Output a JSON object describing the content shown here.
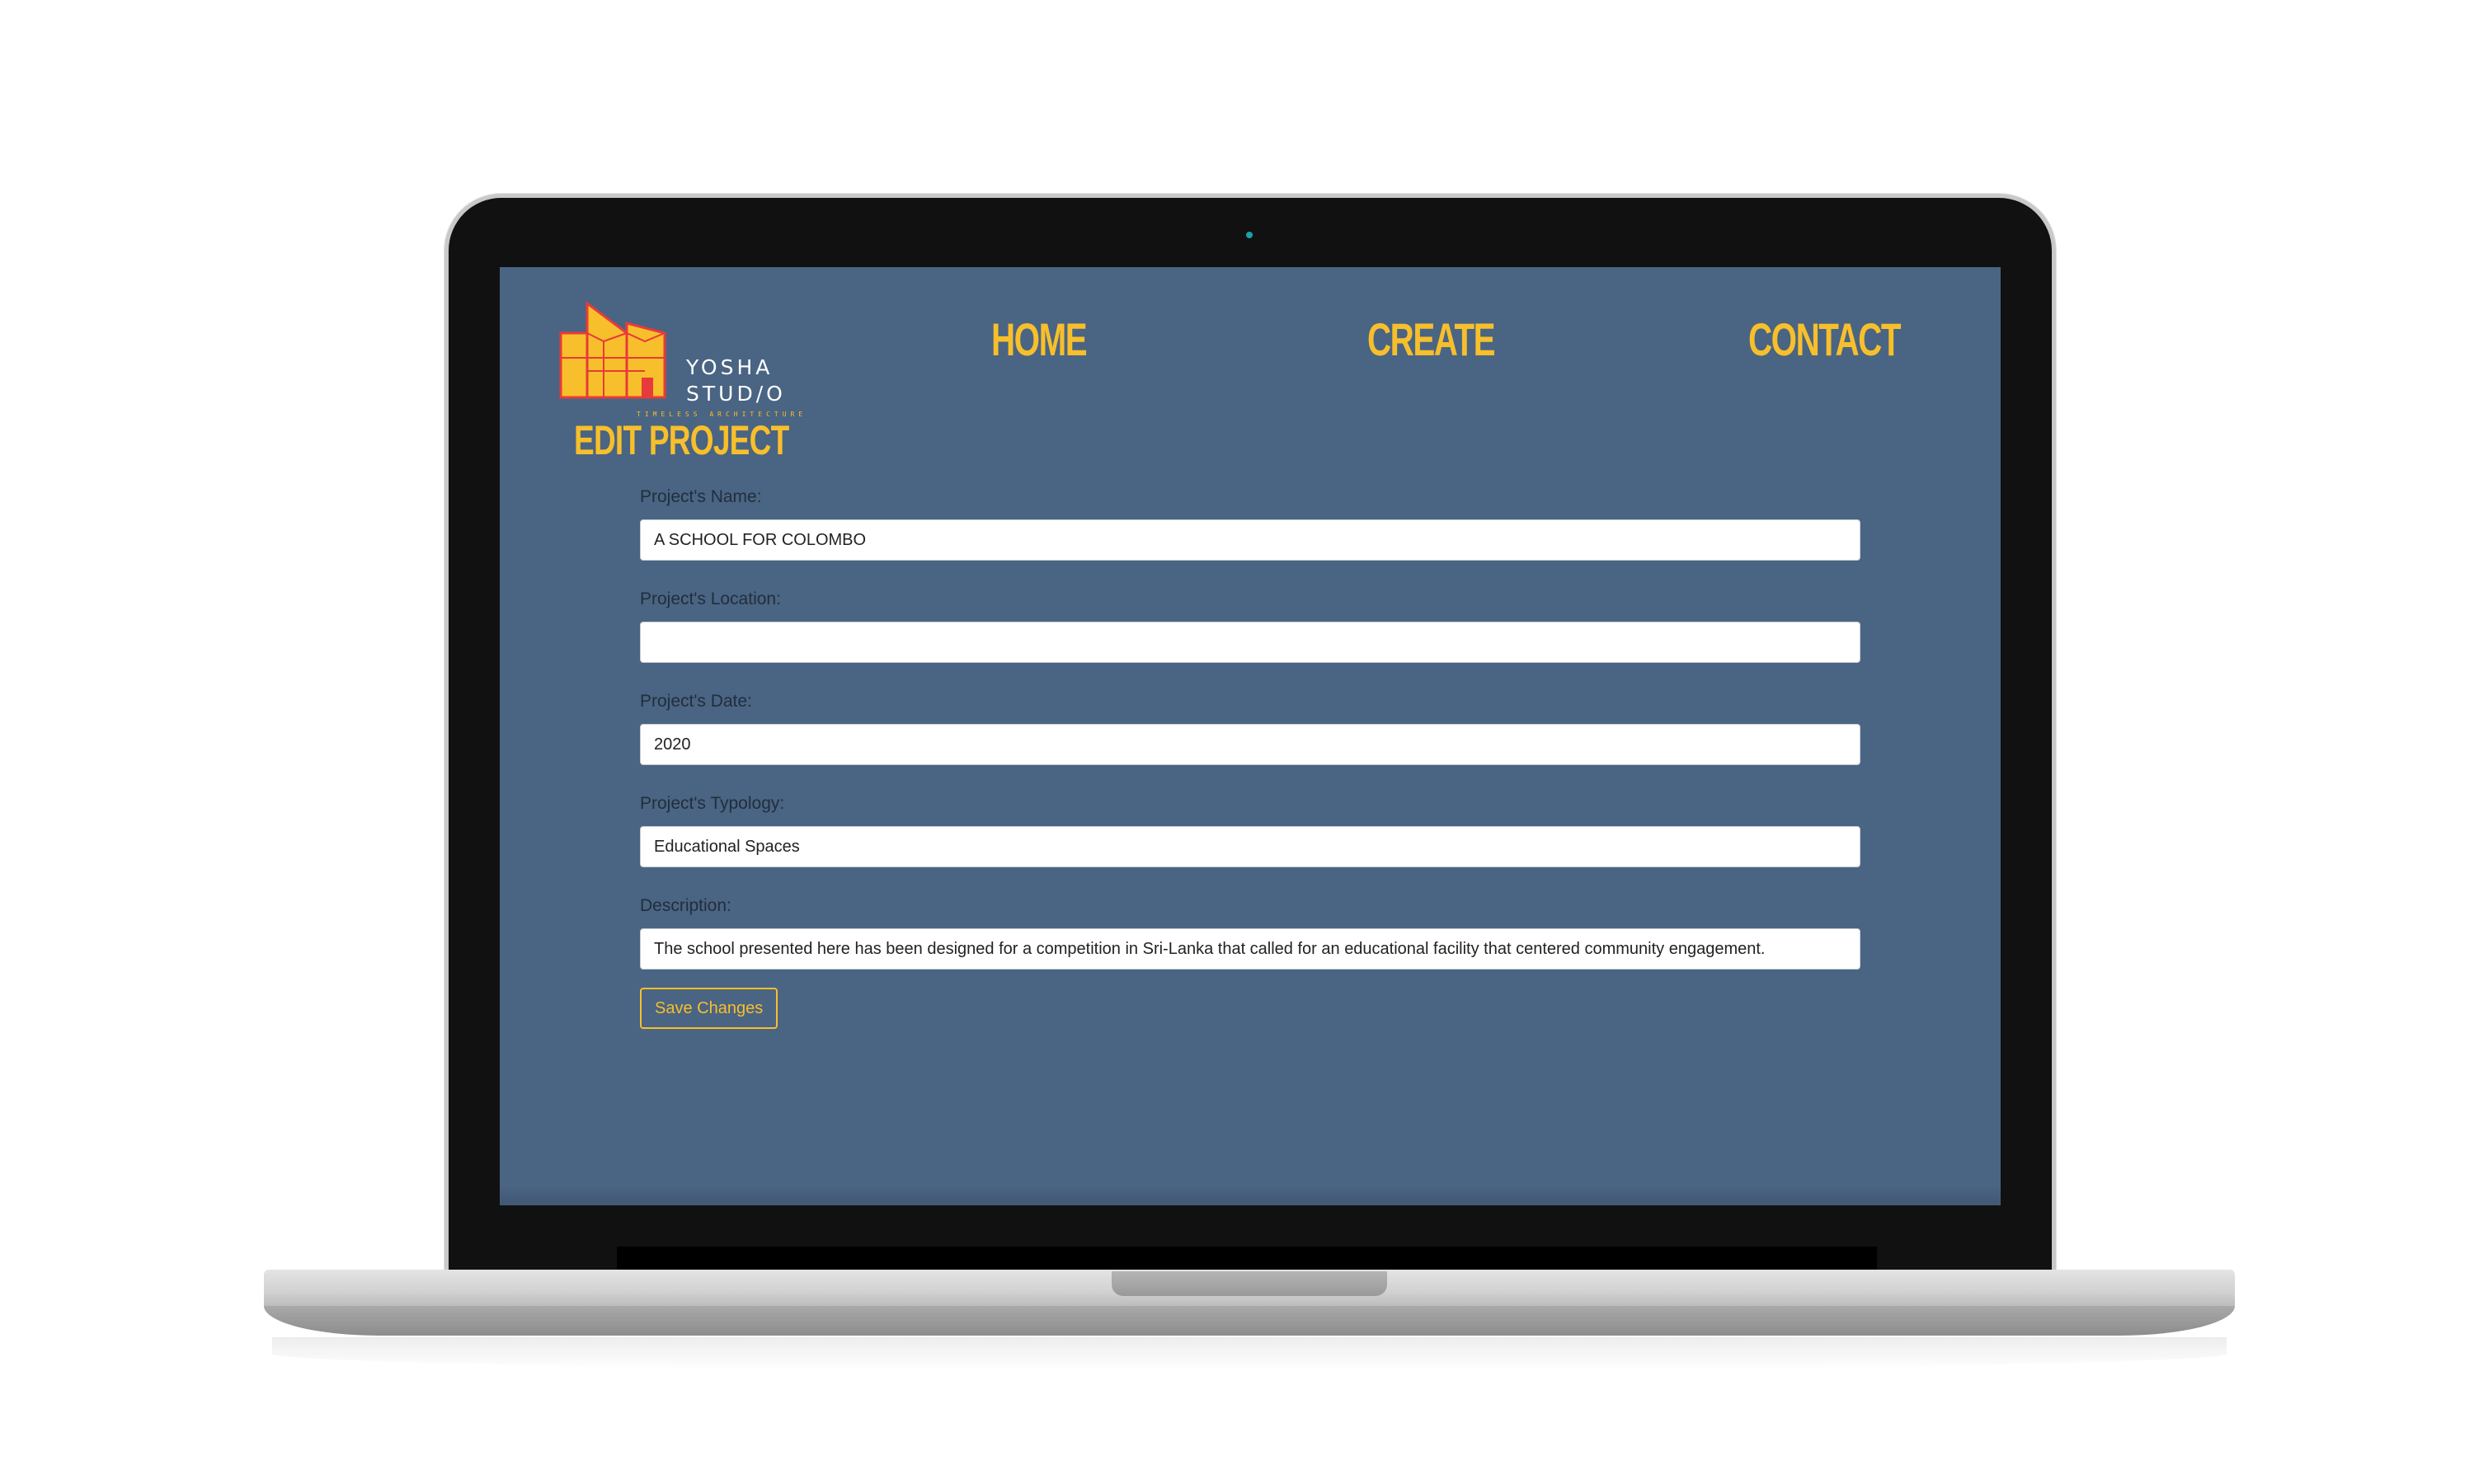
{
  "brand": {
    "name_line1": "YOSHA",
    "name_line2": "STUD/O",
    "tagline": "TIMELESS ARCHITECTURE"
  },
  "nav": {
    "home": "HOME",
    "create": "CREATE",
    "contact": "CONTACT"
  },
  "page": {
    "title": "EDIT PROJECT"
  },
  "form": {
    "name_label": "Project's Name:",
    "name_value": "A SCHOOL FOR COLOMBO",
    "location_label": "Project's Location:",
    "location_value": "",
    "date_label": "Project's Date:",
    "date_value": "2020",
    "typology_label": "Project's Typology:",
    "typology_value": "Educational Spaces",
    "description_label": "Description:",
    "description_value": "The school presented here has been designed for a competition in Sri-Lanka that called for an educational facility that centered community engagement.",
    "save_label": "Save Changes"
  },
  "colors": {
    "background": "#4a6483",
    "accent": "#f7bf2b",
    "logo_outline": "#e83a3a"
  },
  "icons": {
    "logo": "building-logo-icon",
    "camera": "webcam-icon"
  }
}
